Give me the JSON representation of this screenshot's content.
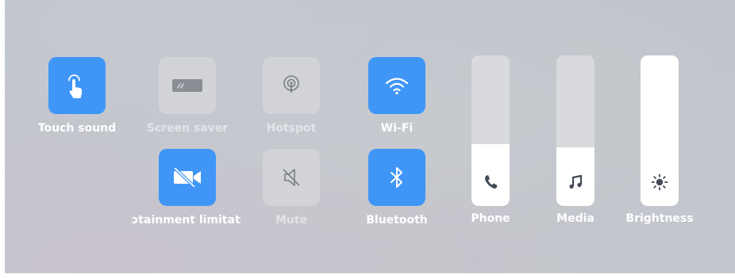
{
  "tiles": {
    "touch_sound": {
      "label": "Touch sound",
      "icon": "touch-icon",
      "active": true
    },
    "screen_saver": {
      "label": "Screen saver",
      "icon": "screen-saver-icon",
      "active": false
    },
    "hotspot": {
      "label": "Hotspot",
      "icon": "hotspot-icon",
      "active": false
    },
    "wifi": {
      "label": "Wi-Fi",
      "icon": "wifi-icon",
      "active": true
    },
    "entertainment_limitation": {
      "label": "ɔtainment limitati",
      "icon": "video-off-icon",
      "active": true
    },
    "mute": {
      "label": "Mute",
      "icon": "speaker-muted-icon",
      "active": false
    },
    "bluetooth": {
      "label": "Bluetooth",
      "icon": "bluetooth-icon",
      "active": true
    }
  },
  "sliders": {
    "phone": {
      "label": "Phone",
      "icon": "phone-icon",
      "level": 0.41
    },
    "media": {
      "label": "Media",
      "icon": "music-note-icon",
      "level": 0.39
    },
    "brightness": {
      "label": "Brightness",
      "icon": "sun-icon",
      "level": 1.0
    }
  },
  "colors": {
    "active_tile": "#3f96f7",
    "inactive_tile": "#d2d3d6",
    "slider_fill": "#ffffff"
  }
}
